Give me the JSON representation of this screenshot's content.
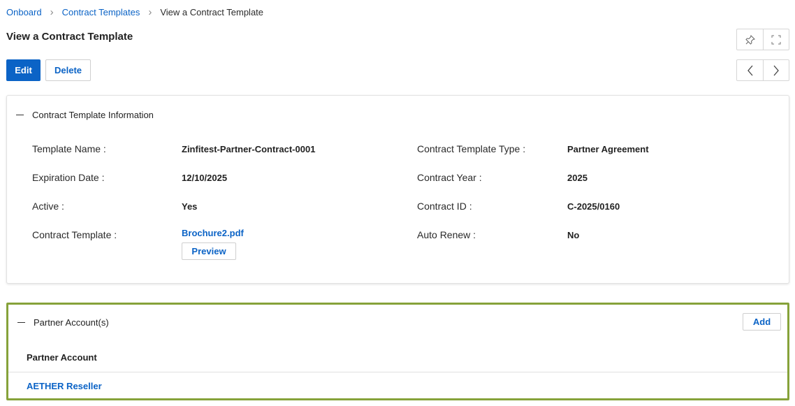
{
  "breadcrumb": {
    "items": [
      "Onboard",
      "Contract Templates"
    ],
    "current": "View a Contract Template"
  },
  "page": {
    "title": "View a Contract Template"
  },
  "toolbar": {
    "edit_label": "Edit",
    "delete_label": "Delete"
  },
  "icons": {
    "pin": "pin-icon",
    "expand": "expand-icon",
    "prev": "chevron-left-icon",
    "next": "chevron-right-icon"
  },
  "info_section": {
    "title": "Contract Template Information",
    "fields": {
      "template_name": {
        "label": "Template Name :",
        "value": "Zinfitest-Partner-Contract-0001"
      },
      "expiration_date": {
        "label": "Expiration Date :",
        "value": "12/10/2025"
      },
      "active": {
        "label": "Active :",
        "value": "Yes"
      },
      "contract_template": {
        "label": "Contract Template :",
        "value": "Brochure2.pdf",
        "preview_label": "Preview"
      },
      "template_type": {
        "label": "Contract Template Type :",
        "value": "Partner Agreement"
      },
      "contract_year": {
        "label": "Contract Year :",
        "value": "2025"
      },
      "contract_id": {
        "label": "Contract ID :",
        "value": "C-2025/0160"
      },
      "auto_renew": {
        "label": "Auto Renew :",
        "value": "No"
      }
    }
  },
  "partners_section": {
    "title": "Partner Account(s)",
    "add_label": "Add",
    "column_header": "Partner Account",
    "rows": [
      "AETHER Reseller"
    ]
  },
  "colors": {
    "accent": "#0b63c6",
    "highlight_border": "#86a23a"
  }
}
